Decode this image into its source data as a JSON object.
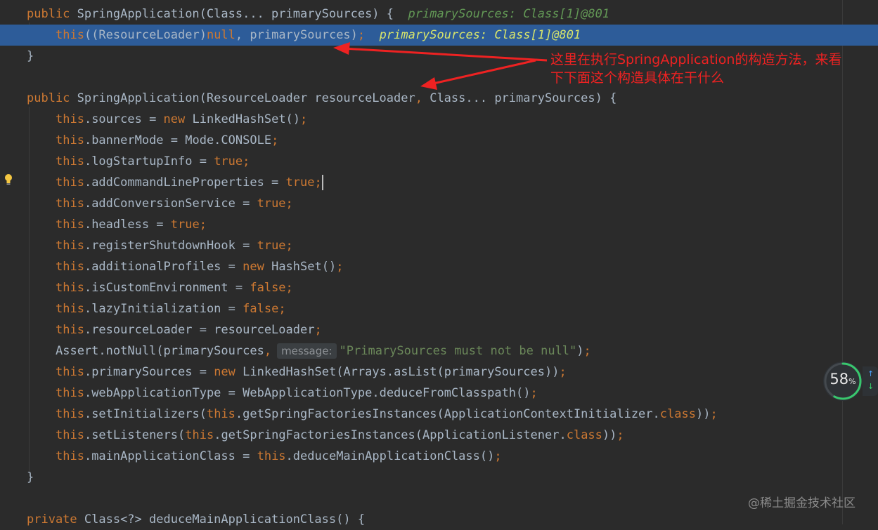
{
  "editor": {
    "lines": [
      {
        "kind": "sig1"
      },
      {
        "kind": "this-call"
      },
      {
        "kind": "close"
      },
      {
        "kind": "blank"
      },
      {
        "kind": "sig2"
      }
    ],
    "sig1": {
      "kw": "public",
      "name": "SpringApplication",
      "params": "(Class... primarySources) {",
      "hint": "primarySources: Class[1]@801"
    },
    "this_call": {
      "this": "this",
      "rest1": "((ResourceLoader)",
      "null": "null",
      "rest2": ", primarySources)",
      "semi": ";",
      "hint": "primarySources: Class[1]@801"
    },
    "close_brace": "}",
    "sig2": {
      "kw": "public",
      "name": "SpringApplication",
      "p1": "(ResourceLoader resourceLoader",
      "comma": ",",
      "p2": " Class... primarySources) {"
    },
    "body": [
      {
        "field": ".sources = ",
        "kw2": "new",
        "val": " LinkedHashSet()",
        "semi": ";"
      },
      {
        "field": ".bannerMode = Mode.CONSOLE",
        "semi": ";"
      },
      {
        "field": ".logStartupInfo = ",
        "lit": "true",
        "semi": ";"
      },
      {
        "field": ".addCommandLineProperties = ",
        "lit": "true",
        "semi": ";"
      },
      {
        "field": ".addConversionService = ",
        "lit": "true",
        "semi": ";"
      },
      {
        "field": ".headless = ",
        "lit": "true",
        "semi": ";"
      },
      {
        "field": ".registerShutdownHook = ",
        "lit": "true",
        "semi": ";"
      },
      {
        "field": ".additionalProfiles = ",
        "kw2": "new",
        "val": " HashSet()",
        "semi": ";"
      },
      {
        "field": ".isCustomEnvironment = ",
        "lit": "false",
        "semi": ";"
      },
      {
        "field": ".lazyInitialization = ",
        "lit": "false",
        "semi": ";"
      },
      {
        "field": ".resourceLoader = resourceLoader",
        "semi": ";"
      }
    ],
    "assert_line": {
      "pre": "Assert.notNull(primarySources",
      "comma": ",",
      "chip": "message:",
      "str": "\"PrimarySources must not be null\"",
      "post": ")",
      "semi": ";"
    },
    "body2": [
      {
        "field": ".primarySources = ",
        "kw2": "new",
        "val": " LinkedHashSet(Arrays.asList(primarySources))",
        "semi": ";"
      },
      {
        "field": ".webApplicationType = WebApplicationType.deduceFromClasspath()",
        "semi": ";"
      },
      {
        "a": ".setInitializers(",
        "this2": "this",
        "b": ".getSpringFactoriesInstances(ApplicationContextInitializer.",
        "cls": "class",
        "c": "))",
        "semi": ";"
      },
      {
        "a": ".setListeners(",
        "this2": "this",
        "b": ".getSpringFactoriesInstances(ApplicationListener.",
        "cls": "class",
        "c": "))",
        "semi": ";"
      },
      {
        "a": ".mainApplicationClass = ",
        "this2": "this",
        "b": ".deduceMainApplicationClass()",
        "semi": ";"
      }
    ],
    "this_kw": "this",
    "close2": "}",
    "last": {
      "kw": "private",
      "rest": " Class<?> deduceMainApplicationClass() {"
    }
  },
  "annotation": {
    "line1": "这里在执行SpringApplication的构造方法，来看",
    "line2": "下下面这个构造具体在干什么",
    "color": "#ee2222"
  },
  "gauge": {
    "value": "58",
    "unit": "%",
    "fraction": 0.58
  },
  "watermark": "@稀土掘金技术社区"
}
